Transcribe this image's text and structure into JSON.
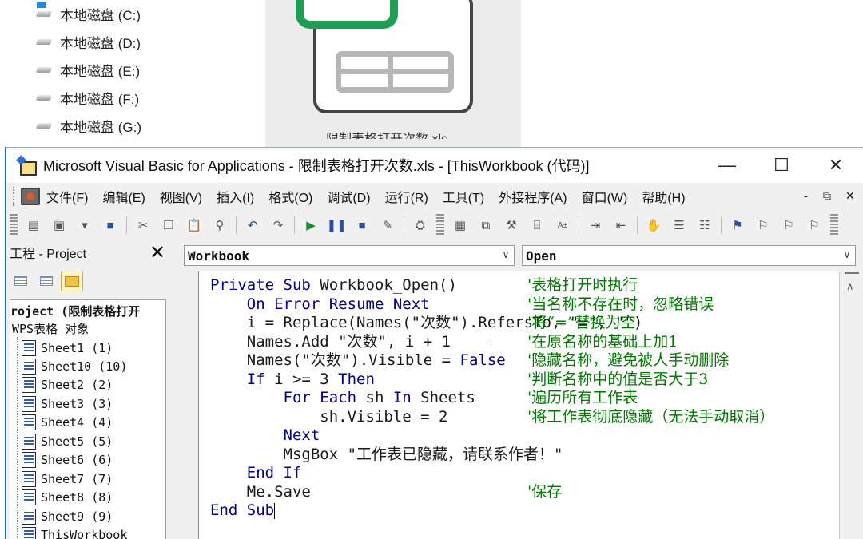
{
  "explorer": {
    "drives": [
      {
        "label": "本地磁盘 (C:)",
        "icon": "windows-drive-icon"
      },
      {
        "label": "本地磁盘 (D:)",
        "icon": "drive-icon"
      },
      {
        "label": "本地磁盘 (E:)",
        "icon": "drive-icon"
      },
      {
        "label": "本地磁盘 (F:)",
        "icon": "drive-icon"
      },
      {
        "label": "本地磁盘 (G:)",
        "icon": "drive-icon"
      }
    ],
    "preview_filename": "限制表格打开次数.xls"
  },
  "window": {
    "title": "Microsoft Visual Basic for Applications - 限制表格打开次数.xls - [ThisWorkbook (代码)]",
    "minimize": "—",
    "maximize": "☐",
    "close": "✕"
  },
  "menu": {
    "items": [
      "文件(F)",
      "编辑(E)",
      "视图(V)",
      "插入(I)",
      "格式(O)",
      "调试(D)",
      "运行(R)",
      "工具(T)",
      "外接程序(A)",
      "窗口(W)",
      "帮助(H)"
    ],
    "mdi_min": "-",
    "mdi_restore": "⧉",
    "mdi_close": "✕"
  },
  "toolbar": {
    "icons": [
      "view-excel-icon",
      "insert-userform-icon",
      "save-icon",
      "cut-icon",
      "copy-icon",
      "paste-icon",
      "find-icon",
      "undo-icon",
      "redo-icon",
      "run-icon",
      "break-icon",
      "reset-icon",
      "design-mode-icon",
      "project-explorer-icon",
      "properties-icon",
      "object-browser-icon",
      "toolbox-icon",
      "indent-icon",
      "outdent-icon",
      "breakpoint-icon",
      "comment-block-icon",
      "uncomment-block-icon",
      "bookmark-icon"
    ]
  },
  "project": {
    "title": "工程 - Project",
    "close_label": "✕",
    "tree_root": "roject (限制表格打开",
    "tree_folder": "WPS表格 对象",
    "sheets": [
      "Sheet1 (1)",
      "Sheet10 (10)",
      "Sheet2 (2)",
      "Sheet3 (3)",
      "Sheet4 (4)",
      "Sheet5 (5)",
      "Sheet6 (6)",
      "Sheet7 (7)",
      "Sheet8 (8)",
      "Sheet9 (9)",
      "ThisWorkbook"
    ]
  },
  "code": {
    "object_combo": "Workbook",
    "procedure_combo": "Open",
    "lines": [
      {
        "code": "Private Sub Workbook_Open()",
        "comment": "'表格打开时执行"
      },
      {
        "code": "    On Error Resume Next",
        "comment": "'当名称不存在时，忽略错误"
      },
      {
        "code": "    i = Replace(Names(\"次数\").RefersTo, \"=\", \"\")",
        "comment": "'将“=”替换为空"
      },
      {
        "code": "    Names.Add \"次数\", i + 1",
        "comment": "'在原名称的基础上加1"
      },
      {
        "code": "    Names(\"次数\").Visible = False",
        "comment": "'隐藏名称，避免被人手动删除"
      },
      {
        "code": "    If i >= 3 Then",
        "comment": "'判断名称中的值是否大于3"
      },
      {
        "code": "        For Each sh In Sheets",
        "comment": "'遍历所有工作表"
      },
      {
        "code": "            sh.Visible = 2",
        "comment": "'将工作表彻底隐藏（无法手动取消）"
      },
      {
        "code": "        Next",
        "comment": ""
      },
      {
        "code": "        MsgBox \"工作表已隐藏，请联系作者！\"",
        "comment": ""
      },
      {
        "code": "    End If",
        "comment": ""
      },
      {
        "code": "    Me.Save",
        "comment": "'保存"
      },
      {
        "code": "End Sub",
        "comment": ""
      }
    ]
  }
}
